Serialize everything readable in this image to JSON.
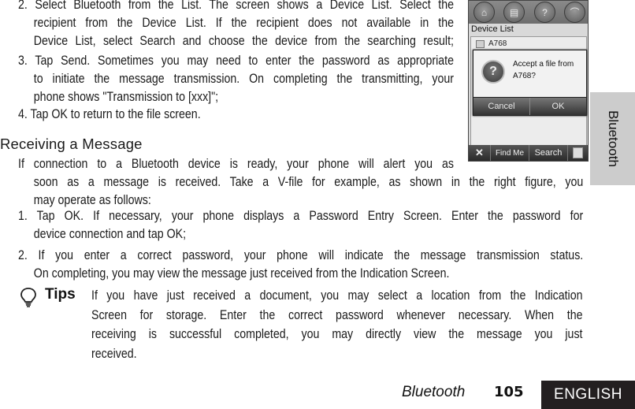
{
  "sending_steps": [
    {
      "lines": [
        "2. Select Bluetooth from the List. The screen shows a Device List. Select the",
        "recipient from the Device List. If the recipient does not available in the",
        "Device List, select Search and choose the device from the searching result;"
      ]
    },
    {
      "lines": [
        "3. Tap Send. Sometimes you may need to enter the password as appropriate",
        "to initiate the message transmission. On completing the transmitting, your",
        "phone shows \"Transmission to [xxx]\";"
      ]
    },
    {
      "lines": [
        "4. Tap OK to return to the file screen."
      ]
    }
  ],
  "receiving": {
    "heading": "Receiving a Message",
    "intro_lines": [
      "If connection to a Bluetooth device is ready, your phone will alert you as",
      "soon as a message is received. Take a V-file for example, as shown in the right figure, you",
      "may operate as follows:"
    ],
    "steps": [
      {
        "lines": [
          "1. Tap OK. If necessary, your phone displays a Password Entry Screen. Enter the password for",
          "device connection and tap OK;"
        ]
      },
      {
        "lines": [
          "2. If you enter a correct password, your phone will indicate the message transmission status.",
          "On completing, you may view the message just received from the Indication Screen."
        ]
      }
    ]
  },
  "tips": {
    "icon": "lightbulb-icon",
    "label": "Tips",
    "lines": [
      "If you have just received a document, you may select a location from the Indication",
      "Screen for storage. Enter the correct password whenever necessary. When the",
      "receiving is successful completed, you may directly view the message you just",
      "received."
    ]
  },
  "phone_screen": {
    "top_icons": [
      "home-icon",
      "contacts-icon",
      "help-icon",
      "hangup-icon"
    ],
    "title": "Device List",
    "device_item": "A768",
    "dialog": {
      "icon": "question-icon",
      "message": "Accept a file from A768?",
      "cancel_label": "Cancel",
      "ok_label": "OK"
    },
    "bottom_bar": {
      "close_glyph": "✕",
      "find_me_label": "Find Me",
      "search_label": "Search",
      "menu_icon": "menu-icon"
    }
  },
  "side_tab": {
    "label": "Bluetooth"
  },
  "footer": {
    "section": "Bluetooth",
    "page_number": "105",
    "language": "ENGLISH"
  }
}
